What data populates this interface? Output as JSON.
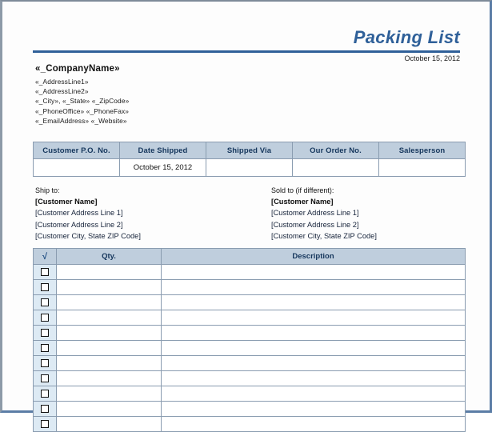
{
  "document": {
    "title": "Packing List",
    "date": "October 15, 2012"
  },
  "company": {
    "name": "«_CompanyName»",
    "lines": [
      "«_AddressLine1»",
      "«_AddressLine2»",
      "«_City», «_State» «_ZipCode»",
      "«_PhoneOffice» «_PhoneFax»",
      "«_EmailAddress» «_Website»"
    ]
  },
  "info_table": {
    "headers": [
      "Customer P.O. No.",
      "Date Shipped",
      "Shipped Via",
      "Our Order No.",
      "Salesperson"
    ],
    "row": [
      "",
      "October 15, 2012",
      "",
      "",
      ""
    ]
  },
  "ship_to": {
    "label": "Ship to:",
    "name": "[Customer Name]",
    "lines": [
      "[Customer Address Line 1]",
      "[Customer Address Line 2]",
      "[Customer City, State ZIP Code]"
    ]
  },
  "sold_to": {
    "label": "Sold to (if different):",
    "name": "[Customer Name]",
    "lines": [
      "[Customer Address Line 1]",
      "[Customer Address Line 2]",
      "[Customer City, State ZIP Code]"
    ]
  },
  "items_table": {
    "headers": [
      "√",
      "Qty.",
      "Description"
    ],
    "row_count": 11,
    "rows": [
      {
        "checked": false,
        "qty": "",
        "description": ""
      },
      {
        "checked": false,
        "qty": "",
        "description": ""
      },
      {
        "checked": false,
        "qty": "",
        "description": ""
      },
      {
        "checked": false,
        "qty": "",
        "description": ""
      },
      {
        "checked": false,
        "qty": "",
        "description": ""
      },
      {
        "checked": false,
        "qty": "",
        "description": ""
      },
      {
        "checked": false,
        "qty": "",
        "description": ""
      },
      {
        "checked": false,
        "qty": "",
        "description": ""
      },
      {
        "checked": false,
        "qty": "",
        "description": ""
      },
      {
        "checked": false,
        "qty": "",
        "description": ""
      },
      {
        "checked": false,
        "qty": "",
        "description": ""
      }
    ]
  },
  "colors": {
    "accent_blue": "#2f6099",
    "header_fill": "#bfcedd",
    "header_text": "#15365c",
    "border": "#8a9cb0",
    "check_cell_fill": "#ddeaf4"
  }
}
